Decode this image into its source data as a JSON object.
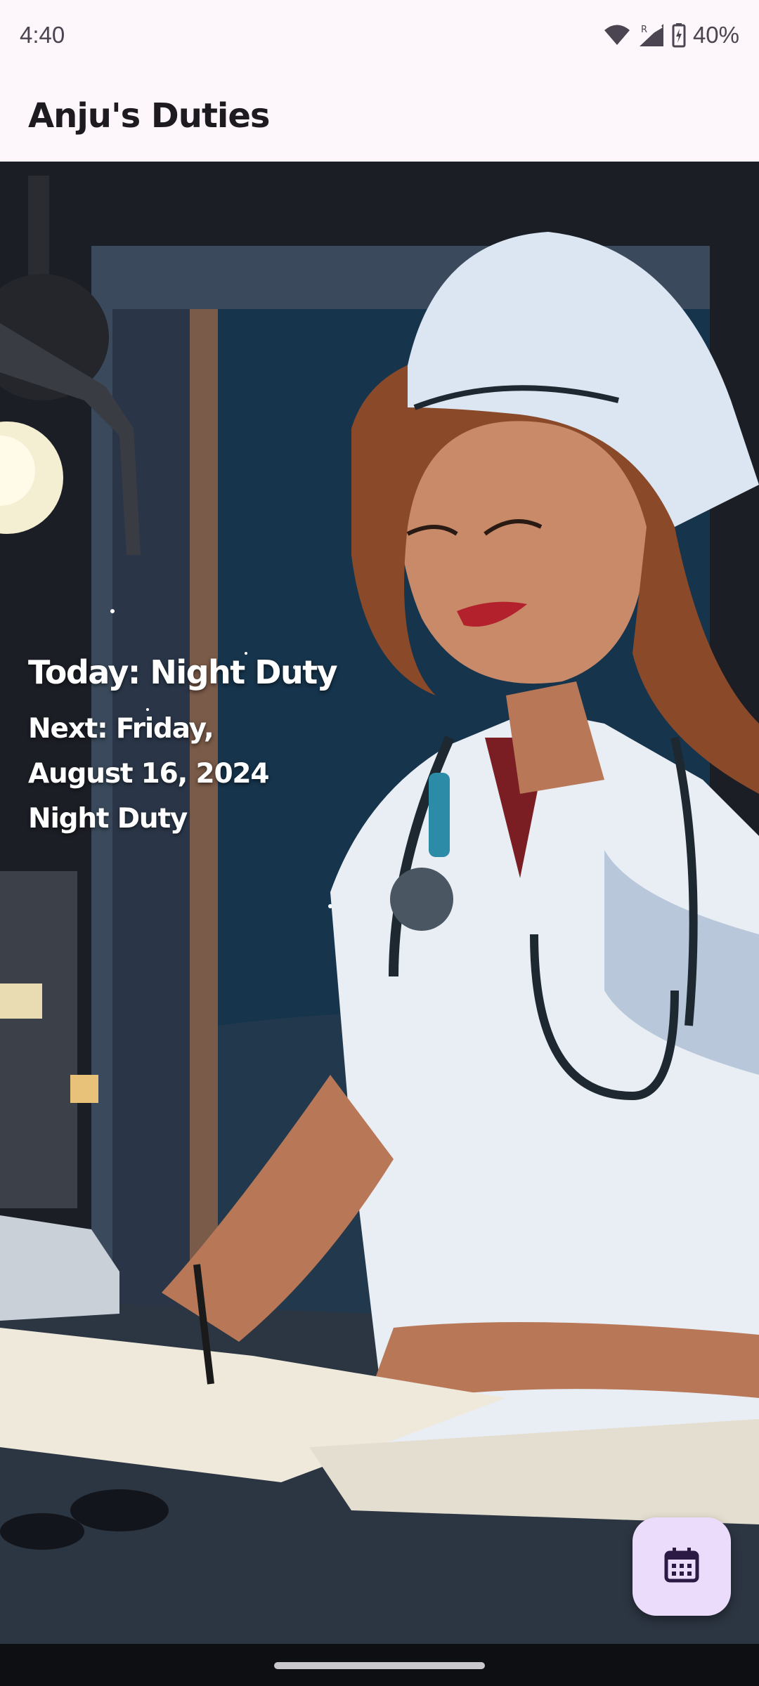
{
  "status_bar": {
    "time": "4:40",
    "battery": "40%",
    "icons": [
      "wifi-icon",
      "signal-roaming-icon",
      "battery-charging-icon"
    ]
  },
  "app_bar": {
    "title": "Anju's Duties"
  },
  "duty": {
    "today": "Today: Night Duty",
    "next_line1": "Next: Friday,",
    "next_line2": "August 16, 2024",
    "next_line3": "Night Duty"
  },
  "fab": {
    "icon": "calendar-icon",
    "color": "#ecdcfb"
  },
  "colors": {
    "app_bar_bg": "#fdf6fb",
    "night_sky": "#1b2a3a"
  }
}
